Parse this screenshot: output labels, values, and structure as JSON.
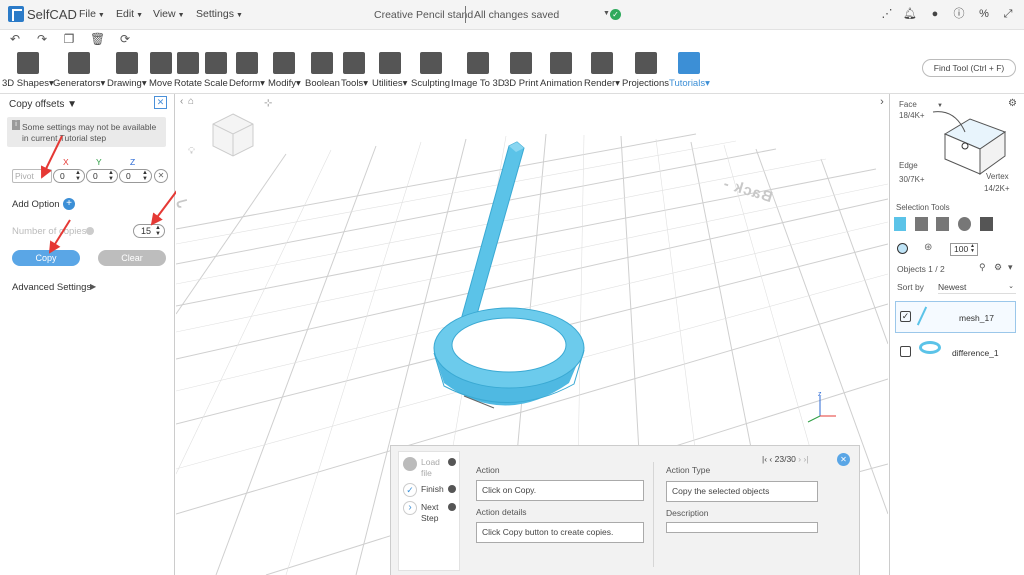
{
  "menubar": {
    "logo": "SelfCAD",
    "menus": [
      "File",
      "Edit",
      "View",
      "Settings"
    ],
    "project_title": "Creative Pencil stand",
    "save_status": "All changes saved"
  },
  "toolbar": {
    "tools": [
      "3D Shapes",
      "Generators",
      "Drawing",
      "Move",
      "Rotate",
      "Scale",
      "Deform",
      "Modify",
      "Boolean",
      "Tools",
      "Utilities",
      "Sculpting",
      "Image To 3D",
      "3D Print",
      "Animation",
      "Render",
      "Projections",
      "Tutorials"
    ],
    "find_tool": "Find Tool (Ctrl + F)"
  },
  "left_panel": {
    "title": "Copy offsets",
    "warning": "Some settings may not be available in current Tutorial step",
    "pivot_placeholder": "Pivot",
    "axes": [
      "X",
      "Y",
      "Z"
    ],
    "offsets": [
      "0",
      "0",
      "0"
    ],
    "add_option": "Add Option",
    "number_of_copies_label": "Number of copies",
    "number_of_copies": "15",
    "copy_button": "Copy",
    "clear_button": "Clear",
    "advanced_settings": "Advanced Settings"
  },
  "viewport": {
    "back_label": "Back -"
  },
  "right_panel": {
    "face_label": "Face",
    "face_count": "18/4K+",
    "edge_label": "Edge",
    "edge_count": "30/7K+",
    "vertex_label": "Vertex",
    "vertex_count": "14/2K+",
    "selection_tools": "Selection Tools",
    "brush_size": "100",
    "objects_label": "Objects 1 / 2",
    "sort_by_label": "Sort by",
    "sort_value": "Newest",
    "objects": [
      {
        "name": "mesh_17",
        "checked": true
      },
      {
        "name": "difference_1",
        "checked": false
      }
    ]
  },
  "tutorial": {
    "steps": [
      "Load file",
      "Finish",
      "Next Step"
    ],
    "pager": "23/30",
    "action_label": "Action",
    "action_value": "Click on Copy.",
    "action_details_label": "Action details",
    "action_details_value": "Click Copy button to create copies.",
    "action_type_label": "Action Type",
    "action_type_value": "Copy the selected objects",
    "description_label": "Description",
    "description_value": ""
  },
  "colors": {
    "accent": "#3c8fd6",
    "model": "#5bc3e8",
    "annotation_arrow": "#e53935"
  }
}
